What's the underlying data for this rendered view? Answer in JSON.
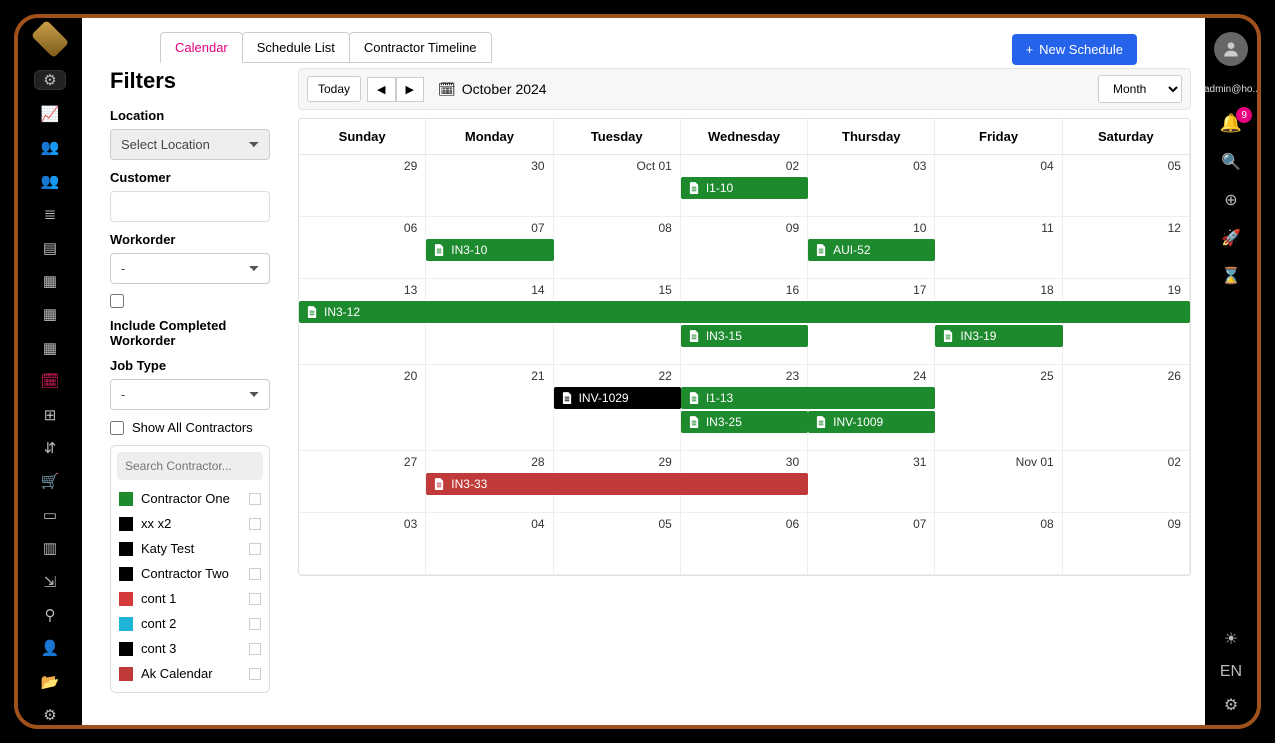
{
  "tabs": [
    "Calendar",
    "Schedule List",
    "Contractor Timeline"
  ],
  "activeTab": 0,
  "newScheduleLabel": "New Schedule",
  "filters": {
    "title": "Filters",
    "locationLabel": "Location",
    "locationValue": "Select Location",
    "customerLabel": "Customer",
    "customerValue": "",
    "workorderLabel": "Workorder",
    "workorderValue": "-",
    "includeCompletedLabel": "Include Completed Workorder",
    "jobTypeLabel": "Job Type",
    "jobTypeValue": "-",
    "showAllLabel": "Show All Contractors",
    "searchPlaceholder": "Search Contractor..."
  },
  "contractors": [
    {
      "name": "Contractor One",
      "color": "#1d8a2e"
    },
    {
      "name": "xx x2",
      "color": "#000"
    },
    {
      "name": "Katy Test",
      "color": "#000"
    },
    {
      "name": "Contractor Two",
      "color": "#000"
    },
    {
      "name": "cont 1",
      "color": "#d43a3a"
    },
    {
      "name": "cont 2",
      "color": "#20b4d8"
    },
    {
      "name": "cont 3",
      "color": "#000"
    },
    {
      "name": "Ak Calendar",
      "color": "#c13a3a"
    }
  ],
  "calendar": {
    "todayLabel": "Today",
    "monthTitle": "October 2024",
    "viewValue": "Month",
    "dayHeaders": [
      "Sunday",
      "Monday",
      "Tuesday",
      "Wednesday",
      "Thursday",
      "Friday",
      "Saturday"
    ],
    "weeks": [
      [
        "29",
        "30",
        "Oct 01",
        "02",
        "03",
        "04",
        "05"
      ],
      [
        "06",
        "07",
        "08",
        "09",
        "10",
        "11",
        "12"
      ],
      [
        "13",
        "14",
        "15",
        "16",
        "17",
        "18",
        "19"
      ],
      [
        "20",
        "21",
        "22",
        "23",
        "24",
        "25",
        "26"
      ],
      [
        "27",
        "28",
        "29",
        "30",
        "31",
        "Nov 01",
        "02"
      ],
      [
        "03",
        "04",
        "05",
        "06",
        "07",
        "08",
        "09"
      ]
    ],
    "events": [
      {
        "week": 0,
        "row": 0,
        "startCol": 3,
        "span": 1,
        "label": "I1-10",
        "color": "#1d8a2e"
      },
      {
        "week": 1,
        "row": 0,
        "startCol": 1,
        "span": 1,
        "label": "IN3-10",
        "color": "#1d8a2e"
      },
      {
        "week": 1,
        "row": 0,
        "startCol": 4,
        "span": 1,
        "label": "AUI-52",
        "color": "#1d8a2e"
      },
      {
        "week": 2,
        "row": 0,
        "startCol": 0,
        "span": 7,
        "label": "IN3-12",
        "color": "#1d8a2e"
      },
      {
        "week": 2,
        "row": 1,
        "startCol": 3,
        "span": 1,
        "label": "IN3-15",
        "color": "#1d8a2e"
      },
      {
        "week": 2,
        "row": 1,
        "startCol": 5,
        "span": 1,
        "label": "IN3-19",
        "color": "#1d8a2e"
      },
      {
        "week": 3,
        "row": 0,
        "startCol": 2,
        "span": 1,
        "label": "INV-1029",
        "color": "#000"
      },
      {
        "week": 3,
        "row": 0,
        "startCol": 3,
        "span": 2,
        "label": "I1-13",
        "color": "#1d8a2e"
      },
      {
        "week": 3,
        "row": 1,
        "startCol": 3,
        "span": 1,
        "label": "IN3-25",
        "color": "#1d8a2e"
      },
      {
        "week": 3,
        "row": 1,
        "startCol": 4,
        "span": 1,
        "label": "INV-1009",
        "color": "#1d8a2e"
      },
      {
        "week": 4,
        "row": 0,
        "startCol": 1,
        "span": 3,
        "label": "IN3-33",
        "color": "#c13a3a"
      }
    ]
  },
  "rightbar": {
    "user": "admin@ho..",
    "notifCount": "9",
    "lang": "EN"
  },
  "leftNav": [
    "filter",
    "chart",
    "users",
    "users2",
    "list",
    "bar",
    "doc1",
    "doc2",
    "doc3",
    "calendar",
    "box",
    "org",
    "cart",
    "card",
    "bar2",
    "export",
    "person",
    "userplain",
    "folder",
    "gear"
  ]
}
